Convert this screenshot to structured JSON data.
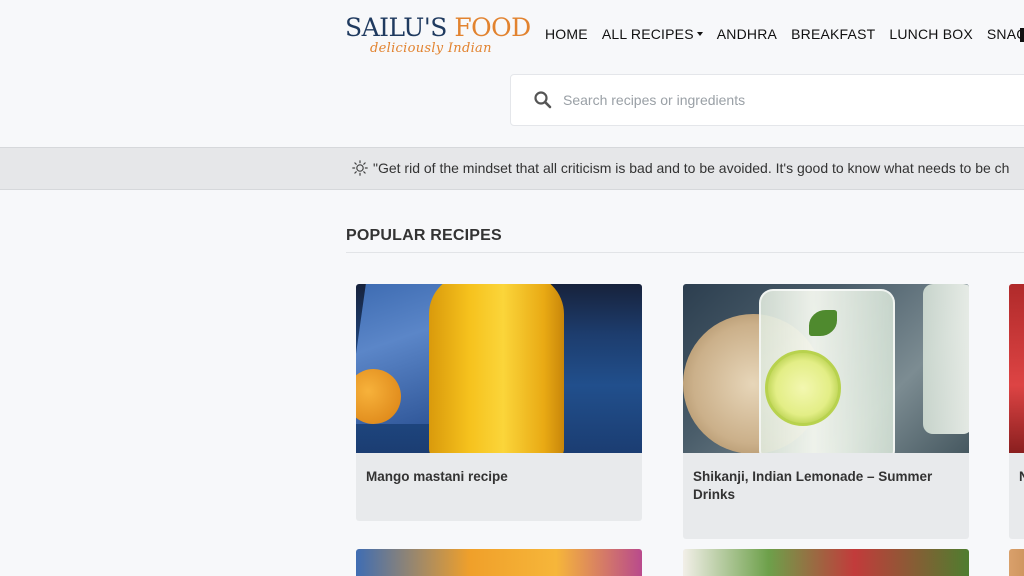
{
  "brand": {
    "name_part1": "SAILU'S",
    "name_part2": "FOOD",
    "tagline": "deliciously Indian"
  },
  "nav": {
    "items": [
      "HOME",
      "ALL RECIPES",
      "ANDHRA",
      "BREAKFAST",
      "LUNCH BOX",
      "SNACKS"
    ]
  },
  "search": {
    "placeholder": "Search recipes or ingredients"
  },
  "quote": {
    "text": "\"Get rid of the mindset that all criticism is bad and to be avoided. It's good to know what needs to be ch"
  },
  "popular": {
    "title": "POPULAR RECIPES",
    "cards": [
      {
        "title": "Mango mastani recipe"
      },
      {
        "title": "Shikanji, Indian Lemonade – Summer Drinks"
      },
      {
        "title": "N"
      }
    ]
  },
  "colors": {
    "brand_navy": "#1f3a5f",
    "brand_orange": "#e2832f",
    "page_bg": "#f7f8fa",
    "card_bg": "#e8eaec"
  },
  "icons": {
    "search": "search-icon",
    "quote": "sun-icon",
    "dropdown": "caret-down-icon"
  }
}
